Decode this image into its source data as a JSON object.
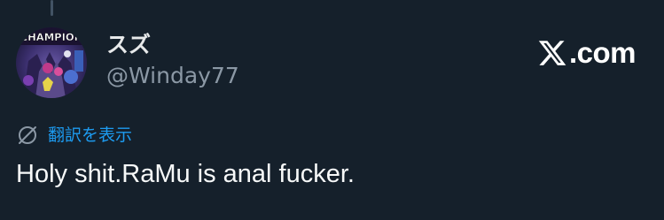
{
  "author": {
    "display_name": "スズ",
    "handle": "@Winday77",
    "avatar_text": "CHAMPION"
  },
  "brand": {
    "text": ".com",
    "icon": "x-logo-icon"
  },
  "translate": {
    "label": "翻訳を表示",
    "icon": "translate-globe-icon"
  },
  "tweet": {
    "text": "Holy shit.RaMu is anal fucker."
  },
  "colors": {
    "background": "#15202b",
    "text_primary": "#e7e9ea",
    "text_secondary": "#8b98a5",
    "link": "#1d9bf0"
  }
}
